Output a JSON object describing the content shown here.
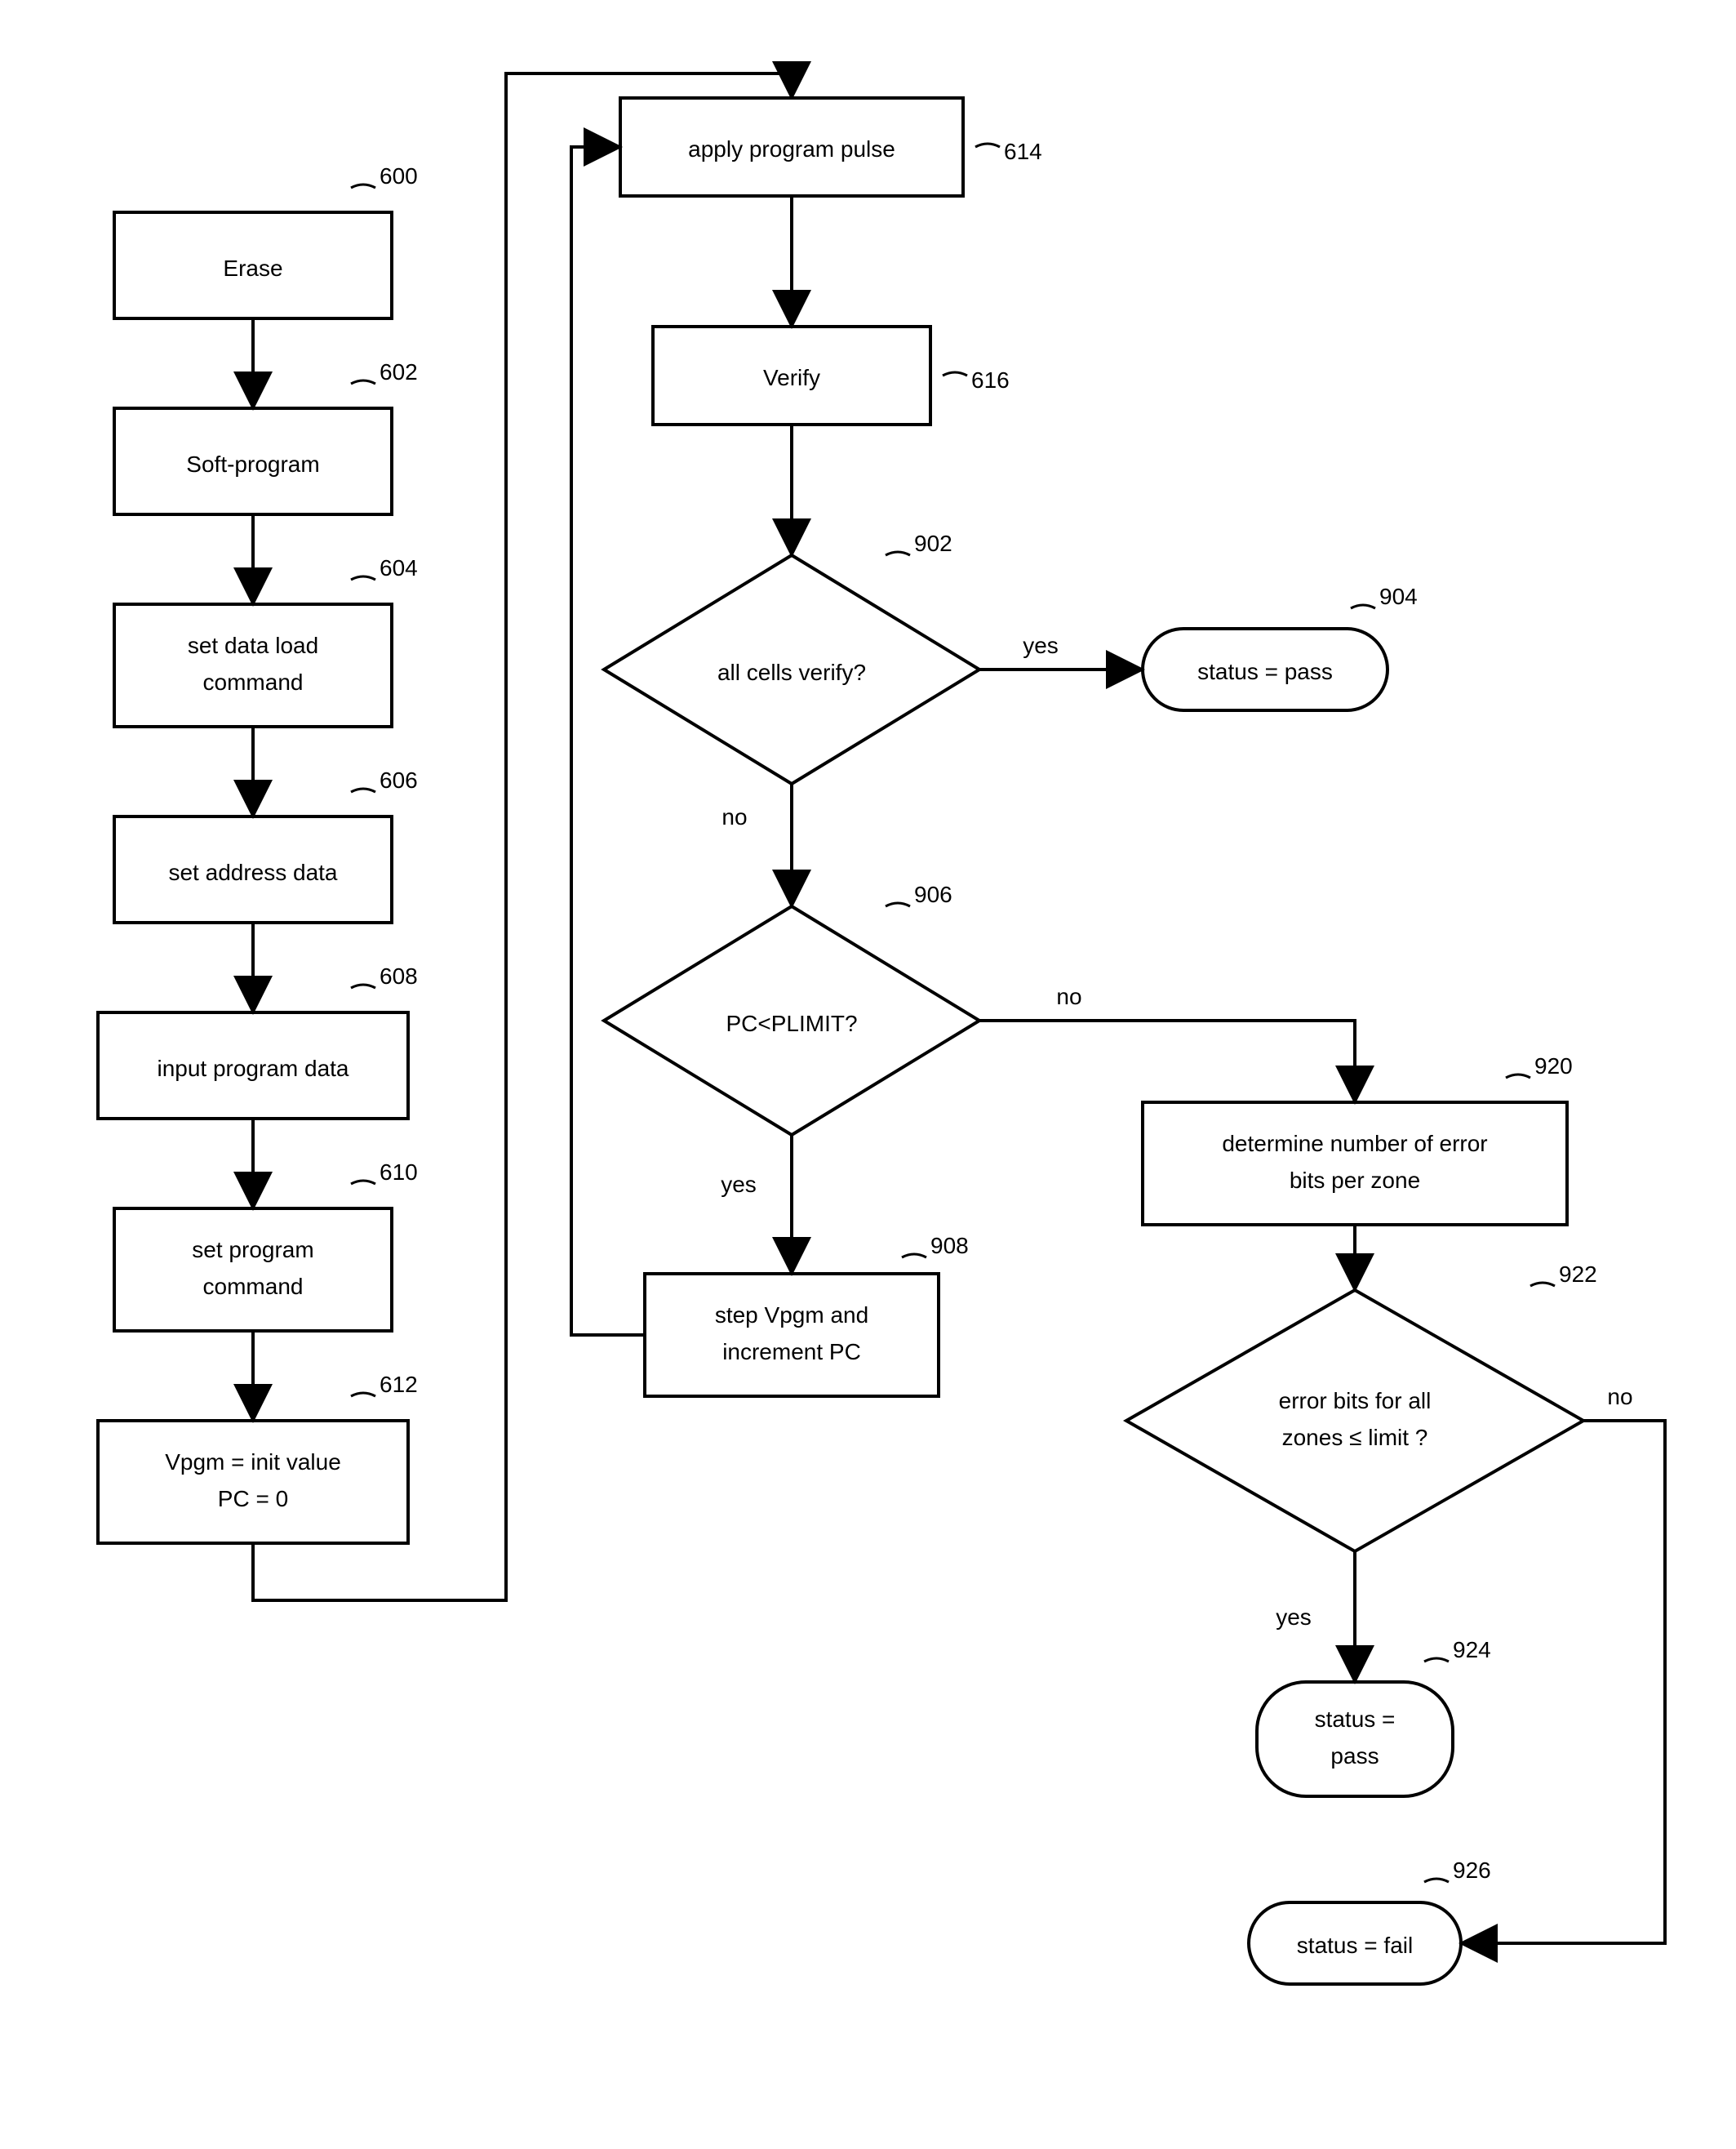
{
  "chart_data": {
    "type": "flowchart",
    "title": "",
    "nodes": [
      {
        "id": "600",
        "type": "process",
        "text": "Erase",
        "ref": "600"
      },
      {
        "id": "602",
        "type": "process",
        "text": "Soft-program",
        "ref": "602"
      },
      {
        "id": "604",
        "type": "process",
        "text": "set data load command",
        "ref": "604"
      },
      {
        "id": "606",
        "type": "process",
        "text": "set address data",
        "ref": "606"
      },
      {
        "id": "608",
        "type": "process",
        "text": "input program data",
        "ref": "608"
      },
      {
        "id": "610",
        "type": "process",
        "text": "set program command",
        "ref": "610"
      },
      {
        "id": "612",
        "type": "process",
        "text": "Vpgm = init value PC = 0",
        "ref": "612"
      },
      {
        "id": "614",
        "type": "process",
        "text": "apply program pulse",
        "ref": "614"
      },
      {
        "id": "616",
        "type": "process",
        "text": "Verify",
        "ref": "616"
      },
      {
        "id": "902",
        "type": "decision",
        "text": "all cells verify?",
        "ref": "902"
      },
      {
        "id": "904",
        "type": "terminator",
        "text": "status = pass",
        "ref": "904"
      },
      {
        "id": "906",
        "type": "decision",
        "text": "PC<PLIMIT?",
        "ref": "906"
      },
      {
        "id": "908",
        "type": "process",
        "text": "step Vpgm and increment PC",
        "ref": "908"
      },
      {
        "id": "920",
        "type": "process",
        "text": "determine number of error bits per zone",
        "ref": "920"
      },
      {
        "id": "922",
        "type": "decision",
        "text": "error bits for all zones ≤ limit ?",
        "ref": "922"
      },
      {
        "id": "924",
        "type": "terminator",
        "text": "status = pass",
        "ref": "924"
      },
      {
        "id": "926",
        "type": "terminator",
        "text": "status = fail",
        "ref": "926"
      }
    ],
    "edges": [
      {
        "from": "600",
        "to": "602"
      },
      {
        "from": "602",
        "to": "604"
      },
      {
        "from": "604",
        "to": "606"
      },
      {
        "from": "606",
        "to": "608"
      },
      {
        "from": "608",
        "to": "610"
      },
      {
        "from": "610",
        "to": "612"
      },
      {
        "from": "612",
        "to": "614"
      },
      {
        "from": "614",
        "to": "616"
      },
      {
        "from": "616",
        "to": "902"
      },
      {
        "from": "902",
        "to": "904",
        "label": "yes"
      },
      {
        "from": "902",
        "to": "906",
        "label": "no"
      },
      {
        "from": "906",
        "to": "908",
        "label": "yes"
      },
      {
        "from": "906",
        "to": "920",
        "label": "no"
      },
      {
        "from": "908",
        "to": "614"
      },
      {
        "from": "920",
        "to": "922"
      },
      {
        "from": "922",
        "to": "924",
        "label": "yes"
      },
      {
        "from": "922",
        "to": "926",
        "label": "no"
      }
    ]
  },
  "boxes": {
    "b600": {
      "text": "Erase",
      "ref": "600"
    },
    "b602": {
      "text": "Soft-program",
      "ref": "602"
    },
    "b604": {
      "line1": "set data load",
      "line2": "command",
      "ref": "604"
    },
    "b606": {
      "text": "set address data",
      "ref": "606"
    },
    "b608": {
      "text": "input program data",
      "ref": "608"
    },
    "b610": {
      "line1": "set program",
      "line2": "command",
      "ref": "610"
    },
    "b612": {
      "line1": "Vpgm = init value",
      "line2": "PC = 0",
      "ref": "612"
    },
    "b614": {
      "text": "apply program pulse",
      "ref": "614"
    },
    "b616": {
      "text": "Verify",
      "ref": "616"
    },
    "b902": {
      "text": "all cells verify?",
      "ref": "902"
    },
    "b904": {
      "text": "status = pass",
      "ref": "904"
    },
    "b906": {
      "text": "PC<PLIMIT?",
      "ref": "906"
    },
    "b908": {
      "line1": "step Vpgm and",
      "line2": "increment PC",
      "ref": "908"
    },
    "b920": {
      "line1": "determine number of error",
      "line2": "bits per zone",
      "ref": "920"
    },
    "b922": {
      "line1": "error bits for all",
      "line2": "zones ≤ limit ?",
      "ref": "922"
    },
    "b924": {
      "line1": "status =",
      "line2": "pass",
      "ref": "924"
    },
    "b926": {
      "text": "status = fail",
      "ref": "926"
    }
  },
  "labels": {
    "yes": "yes",
    "no": "no"
  }
}
